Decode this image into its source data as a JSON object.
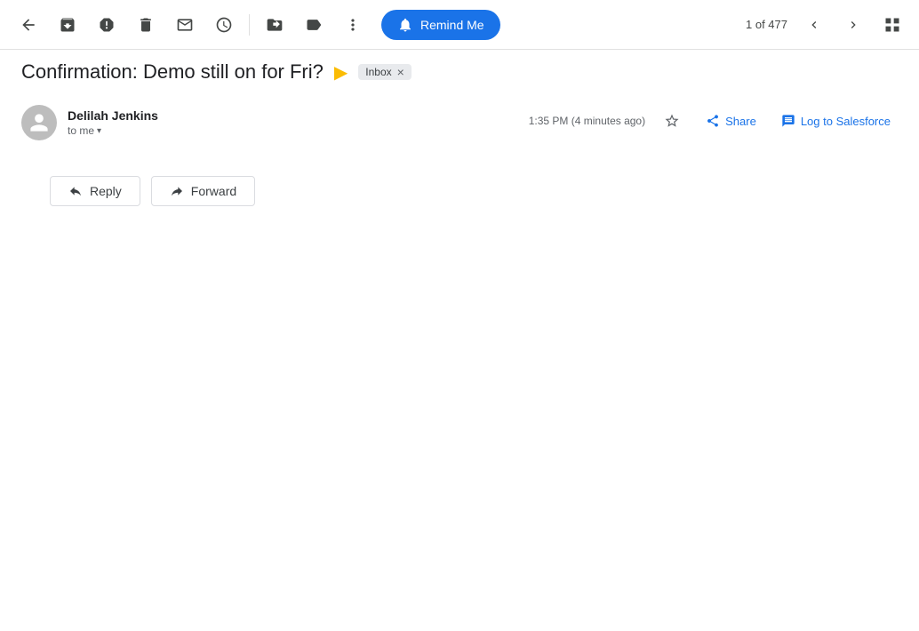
{
  "toolbar": {
    "back_label": "Back",
    "archive_label": "Archive",
    "report_spam_label": "Report spam",
    "delete_label": "Delete",
    "mark_as_unread_label": "Mark as unread",
    "snooze_label": "Snooze",
    "move_to_label": "Move to",
    "label_as_label": "Label as",
    "more_options_label": "More options",
    "remind_me_label": "Remind Me",
    "pagination_current": "1",
    "pagination_of": "of 477",
    "nav_prev_label": "Newer",
    "nav_next_label": "Older",
    "grid_label": "Grid view"
  },
  "subject": {
    "title": "Confirmation: Demo still on for Fri?",
    "tag": "▶",
    "inbox_badge": "Inbox",
    "inbox_close": "×"
  },
  "message": {
    "sender_name": "Delilah Jenkins",
    "sender_to": "to me",
    "timestamp": "1:35 PM (4 minutes ago)",
    "star_label": "Star",
    "share_label": "Share",
    "log_salesforce_label": "Log to Salesforce"
  },
  "actions": {
    "reply_label": "Reply",
    "forward_label": "Forward"
  },
  "colors": {
    "remind_me_bg": "#1a73e8",
    "link_color": "#1a73e8",
    "tag_color": "#fbbc04"
  }
}
